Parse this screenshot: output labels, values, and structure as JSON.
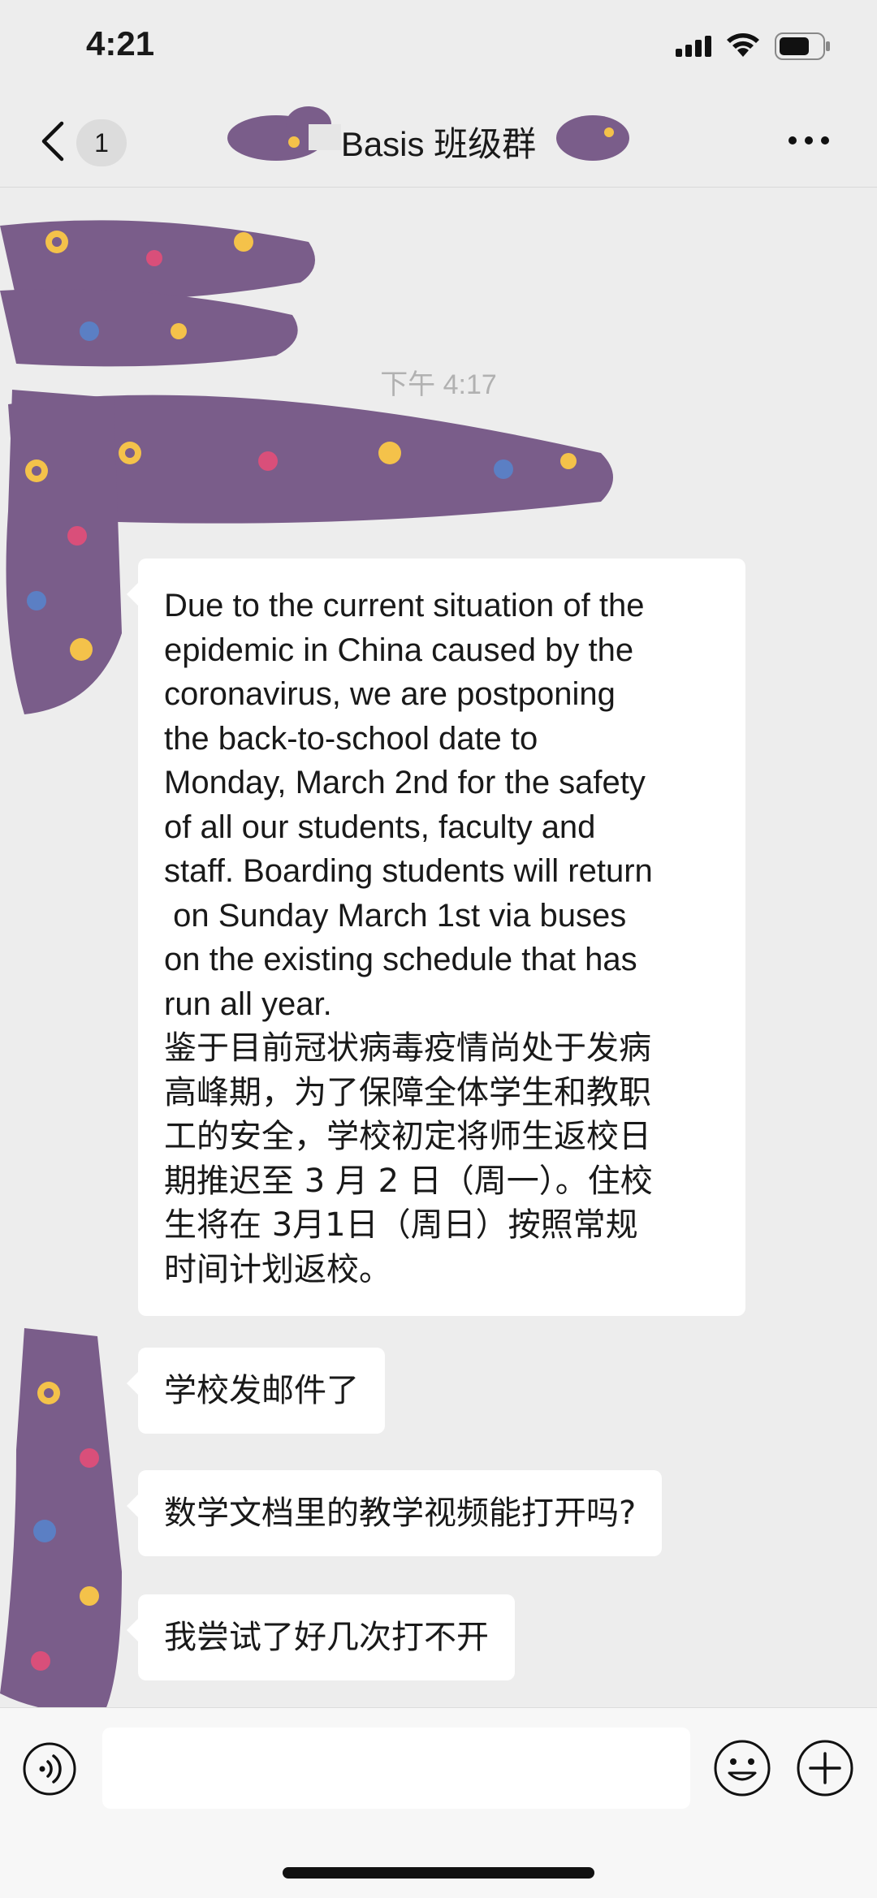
{
  "status_bar": {
    "time": "4:21",
    "icons": [
      "signal-icon",
      "wifi-icon",
      "battery-icon"
    ]
  },
  "nav": {
    "back_icon": "chevron-left-icon",
    "unread_count": "1",
    "title": "Basis 班级群",
    "more_icon": "more-icon"
  },
  "chat": {
    "timestamp": "下午 4:17",
    "messages": [
      {
        "lines": [
          "Due to the current situation of the",
          "epidemic in China caused by the",
          "coronavirus, we are postponing",
          "the back-to-school date to",
          "Monday, March 2nd for the safety",
          "of all our students, faculty and",
          "staff. Boarding students will return",
          " on Sunday March 1st via buses",
          "on the existing schedule that has",
          "run all year.",
          "鉴于目前冠状病毒疫情尚处于发病",
          "高峰期，为了保障全体学生和教职",
          "工的安全，学校初定将师生返校日",
          "期推迟至 3 月 2 日（周一）。住校",
          "生将在 3月1日（周日）按照常规",
          "时间计划返校。"
        ]
      },
      {
        "text": "学校发邮件了"
      },
      {
        "text": "数学文档里的教学视频能打开吗?"
      },
      {
        "text": "我尝试了好几次打不开"
      }
    ]
  },
  "input_bar": {
    "voice_icon": "voice-icon",
    "input_value": "",
    "emoji_icon": "emoji-icon",
    "add_icon": "plus-circle-icon"
  },
  "colors": {
    "background": "#ededed",
    "bubble": "#ffffff",
    "redaction": "#7a5d8a"
  }
}
